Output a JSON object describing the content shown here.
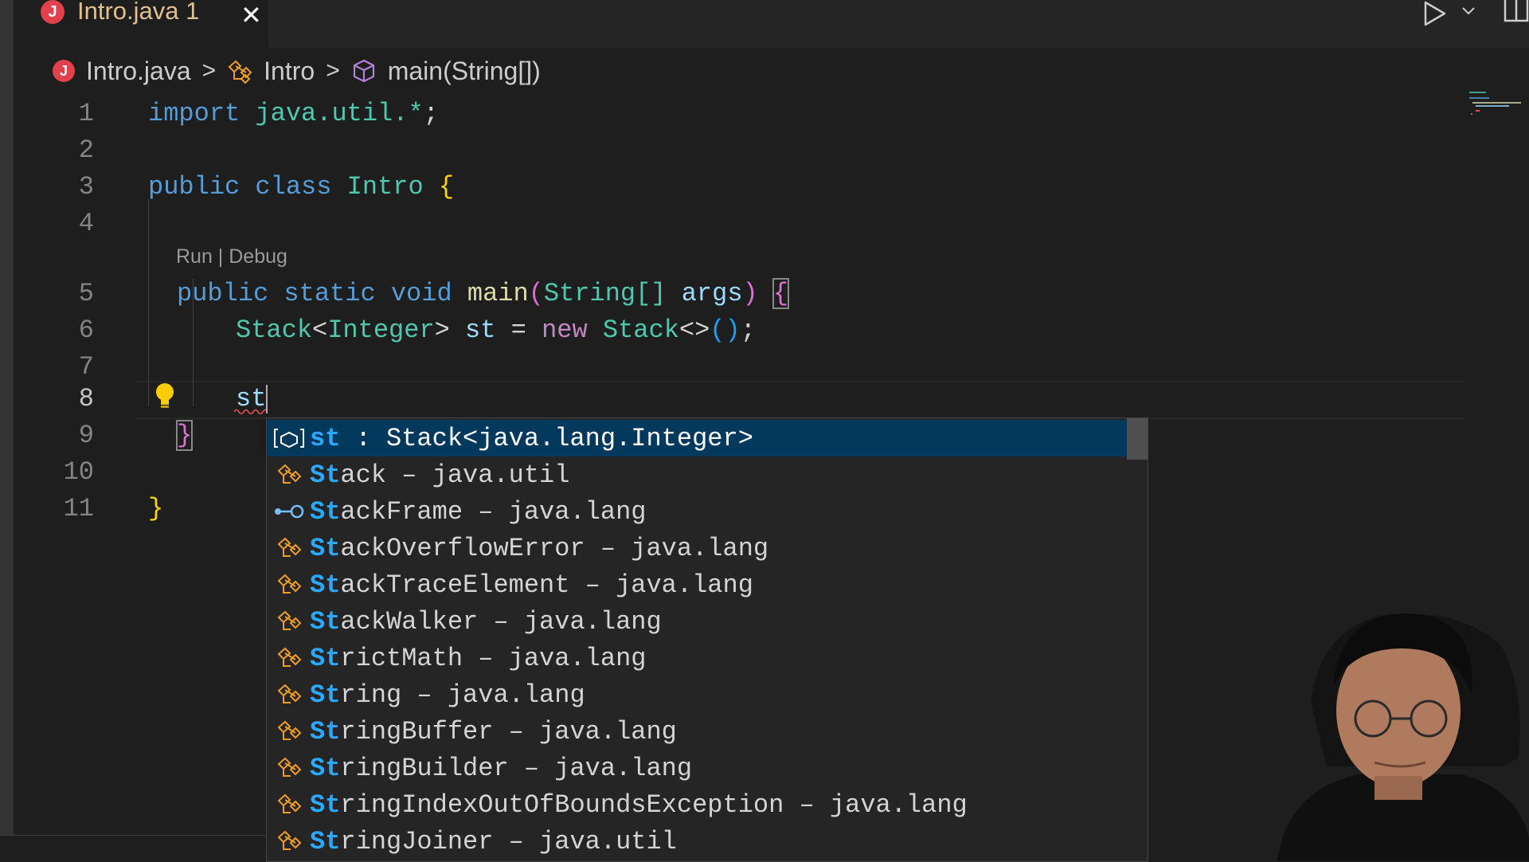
{
  "tab": {
    "icon_letter": "J",
    "label": "Intro.java 1",
    "close_glyph": "✕"
  },
  "breadcrumb": {
    "file": "Intro.java",
    "class_name": "Intro",
    "method": "main(String[])",
    "separator": ">"
  },
  "codelens": {
    "text": "Run | Debug"
  },
  "editor": {
    "current_line": 8,
    "lines": [
      {
        "number": "1",
        "text": "import java.util.*;"
      },
      {
        "number": "2",
        "text": ""
      },
      {
        "number": "3",
        "text": "public class Intro {"
      },
      {
        "number": "4",
        "text": ""
      },
      {
        "number": "5",
        "text": "public static void main(String[] args) {"
      },
      {
        "number": "6",
        "text": "Stack<Integer> st = new Stack<>();"
      },
      {
        "number": "7",
        "text": ""
      },
      {
        "number": "8",
        "text": "st"
      },
      {
        "number": "9",
        "text": "}"
      },
      {
        "number": "10",
        "text": ""
      },
      {
        "number": "11",
        "text": "}"
      }
    ],
    "tokens": {
      "import": "import",
      "java_util": "java.util.*",
      "semicolon": ";",
      "public": "public",
      "class": "class",
      "intro": "Intro",
      "brace_open": "{",
      "brace_close": "}",
      "static": "static",
      "void": "void",
      "main": "main",
      "paren_open": "(",
      "string_arr": "String[]",
      "args": "args",
      "paren_close": ")",
      "stack": "Stack",
      "lt": "<",
      "integer": "Integer",
      "gt": ">",
      "st": "st",
      "eq": "=",
      "new": "new",
      "diamond": "<>",
      "parens": "()"
    }
  },
  "suggestions": [
    {
      "kind": "variable",
      "icon": "variable-icon",
      "match": "st",
      "rest": "",
      "detail": " : Stack<java.lang.Integer>",
      "selected": true
    },
    {
      "kind": "class",
      "icon": "class-icon",
      "match": "St",
      "rest": "ack",
      "detail": " – java.util"
    },
    {
      "kind": "interface",
      "icon": "interface-icon",
      "match": "St",
      "rest": "ackFrame",
      "detail": " – java.lang"
    },
    {
      "kind": "class",
      "icon": "class-icon",
      "match": "St",
      "rest": "ackOverflowError",
      "detail": " – java.lang"
    },
    {
      "kind": "class",
      "icon": "class-icon",
      "match": "St",
      "rest": "ackTraceElement",
      "detail": " – java.lang"
    },
    {
      "kind": "class",
      "icon": "class-icon",
      "match": "St",
      "rest": "ackWalker",
      "detail": " – java.lang"
    },
    {
      "kind": "class",
      "icon": "class-icon",
      "match": "St",
      "rest": "rictMath",
      "detail": " – java.lang"
    },
    {
      "kind": "class",
      "icon": "class-icon",
      "match": "St",
      "rest": "ring",
      "detail": " – java.lang"
    },
    {
      "kind": "class",
      "icon": "class-icon",
      "match": "St",
      "rest": "ringBuffer",
      "detail": " – java.lang"
    },
    {
      "kind": "class",
      "icon": "class-icon",
      "match": "St",
      "rest": "ringBuilder",
      "detail": " – java.lang"
    },
    {
      "kind": "class",
      "icon": "class-icon",
      "match": "St",
      "rest": "ringIndexOutOfBoundsException",
      "detail": " – java.lang"
    },
    {
      "kind": "class",
      "icon": "class-icon",
      "match": "St",
      "rest": "ringJoiner",
      "detail": " – java.util"
    }
  ],
  "colors": {
    "keyword": "#569cd6",
    "type": "#4ec9b0",
    "function": "#dcdcaa",
    "variable": "#9cdcfe",
    "match": "#2aaaff",
    "selection": "#04395e",
    "class_icon": "#ee9d28",
    "tab_modified": "#e2c08d"
  }
}
